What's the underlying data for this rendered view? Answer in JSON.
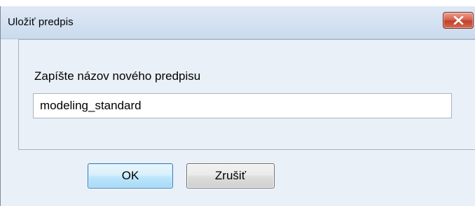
{
  "window": {
    "title": "Uložiť predpis",
    "close_icon": "close-icon"
  },
  "form": {
    "prompt": "Zapíšte názov nového predpisu",
    "name_value": "modeling_standard"
  },
  "buttons": {
    "ok_label": "OK",
    "cancel_label": "Zrušiť"
  },
  "colors": {
    "title_bar": "#c9dbee",
    "dialog_background": "#eaf0f7",
    "close_button": "#c0402c",
    "default_button_border": "#3c7fb1"
  }
}
